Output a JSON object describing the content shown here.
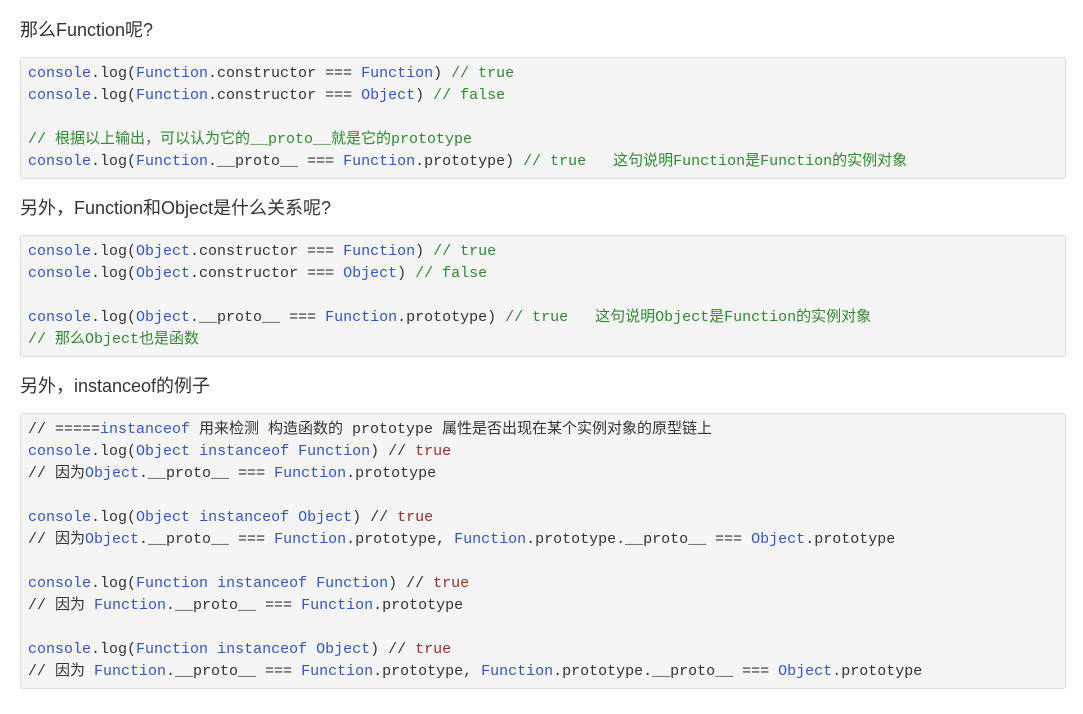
{
  "article": {
    "sections": [
      {
        "heading": "那么Function呢?",
        "lines": [
          [
            {
              "t": "console",
              "c": "#3355cc"
            },
            {
              "t": ".log("
            },
            {
              "t": "Function",
              "c": "#3355cc"
            },
            {
              "t": ".constructor === "
            },
            {
              "t": "Function",
              "c": "#3355cc"
            },
            {
              "t": ") "
            },
            {
              "t": "// true",
              "c": "#2f8b2f"
            }
          ],
          [
            {
              "t": "console",
              "c": "#3355cc"
            },
            {
              "t": ".log("
            },
            {
              "t": "Function",
              "c": "#3355cc"
            },
            {
              "t": ".constructor === "
            },
            {
              "t": "Object",
              "c": "#3355cc"
            },
            {
              "t": ") "
            },
            {
              "t": "// false",
              "c": "#2f8b2f"
            }
          ],
          [],
          [
            {
              "t": "// 根据以上输出，可以认为它的__proto__就是它的prototype",
              "c": "#2f8b2f"
            }
          ],
          [
            {
              "t": "console",
              "c": "#3355cc"
            },
            {
              "t": ".log("
            },
            {
              "t": "Function",
              "c": "#3355cc"
            },
            {
              "t": ".__proto__ === "
            },
            {
              "t": "Function",
              "c": "#3355cc"
            },
            {
              "t": ".prototype) "
            },
            {
              "t": "// true   这句说明Function是Function的实例对象",
              "c": "#2f8b2f"
            }
          ]
        ]
      },
      {
        "heading": "另外，Function和Object是什么关系呢?",
        "lines": [
          [
            {
              "t": "console",
              "c": "#3355cc"
            },
            {
              "t": ".log("
            },
            {
              "t": "Object",
              "c": "#3355cc"
            },
            {
              "t": ".constructor === "
            },
            {
              "t": "Function",
              "c": "#3355cc"
            },
            {
              "t": ") "
            },
            {
              "t": "// true",
              "c": "#2f8b2f"
            }
          ],
          [
            {
              "t": "console",
              "c": "#3355cc"
            },
            {
              "t": ".log("
            },
            {
              "t": "Object",
              "c": "#3355cc"
            },
            {
              "t": ".constructor === "
            },
            {
              "t": "Object",
              "c": "#3355cc"
            },
            {
              "t": ") "
            },
            {
              "t": "// false",
              "c": "#2f8b2f"
            }
          ],
          [],
          [
            {
              "t": "console",
              "c": "#3355cc"
            },
            {
              "t": ".log("
            },
            {
              "t": "Object",
              "c": "#3355cc"
            },
            {
              "t": ".__proto__ === "
            },
            {
              "t": "Function",
              "c": "#3355cc"
            },
            {
              "t": ".prototype) "
            },
            {
              "t": "// true   这句说明Object是Function的实例对象",
              "c": "#2f8b2f"
            }
          ],
          [
            {
              "t": "// 那么Object也是函数",
              "c": "#2f8b2f"
            }
          ]
        ]
      },
      {
        "heading": "另外，instanceof的例子",
        "lines": [
          [
            {
              "t": "// ====="
            },
            {
              "t": "instanceof",
              "c": "#3355cc"
            },
            {
              "t": " 用来检测 构造函数的 prototype 属性是否出现在某个实例对象的原型链上"
            }
          ],
          [
            {
              "t": "console",
              "c": "#3355cc"
            },
            {
              "t": ".log("
            },
            {
              "t": "Object",
              "c": "#3355cc"
            },
            {
              "t": " "
            },
            {
              "t": "instanceof",
              "c": "#3355cc"
            },
            {
              "t": " "
            },
            {
              "t": "Function",
              "c": "#3355cc"
            },
            {
              "t": ") // "
            },
            {
              "t": "true",
              "c": "#a52a2a"
            }
          ],
          [
            {
              "t": "// 因为"
            },
            {
              "t": "Object",
              "c": "#3355cc"
            },
            {
              "t": ".__proto__ === "
            },
            {
              "t": "Function",
              "c": "#3355cc"
            },
            {
              "t": ".prototype"
            }
          ],
          [],
          [
            {
              "t": "console",
              "c": "#3355cc"
            },
            {
              "t": ".log("
            },
            {
              "t": "Object",
              "c": "#3355cc"
            },
            {
              "t": " "
            },
            {
              "t": "instanceof",
              "c": "#3355cc"
            },
            {
              "t": " "
            },
            {
              "t": "Object",
              "c": "#3355cc"
            },
            {
              "t": ") // "
            },
            {
              "t": "true",
              "c": "#a52a2a"
            }
          ],
          [
            {
              "t": "// 因为"
            },
            {
              "t": "Object",
              "c": "#3355cc"
            },
            {
              "t": ".__proto__ === "
            },
            {
              "t": "Function",
              "c": "#3355cc"
            },
            {
              "t": ".prototype, "
            },
            {
              "t": "Function",
              "c": "#3355cc"
            },
            {
              "t": ".prototype.__proto__ === "
            },
            {
              "t": "Object",
              "c": "#3355cc"
            },
            {
              "t": ".prototype"
            }
          ],
          [],
          [
            {
              "t": "console",
              "c": "#3355cc"
            },
            {
              "t": ".log("
            },
            {
              "t": "Function",
              "c": "#3355cc"
            },
            {
              "t": " "
            },
            {
              "t": "instanceof",
              "c": "#3355cc"
            },
            {
              "t": " "
            },
            {
              "t": "Function",
              "c": "#3355cc"
            },
            {
              "t": ") // "
            },
            {
              "t": "true",
              "c": "#a52a2a"
            }
          ],
          [
            {
              "t": "// 因为 "
            },
            {
              "t": "Function",
              "c": "#3355cc"
            },
            {
              "t": ".__proto__ === "
            },
            {
              "t": "Function",
              "c": "#3355cc"
            },
            {
              "t": ".prototype"
            }
          ],
          [],
          [
            {
              "t": "console",
              "c": "#3355cc"
            },
            {
              "t": ".log("
            },
            {
              "t": "Function",
              "c": "#3355cc"
            },
            {
              "t": " "
            },
            {
              "t": "instanceof",
              "c": "#3355cc"
            },
            {
              "t": " "
            },
            {
              "t": "Object",
              "c": "#3355cc"
            },
            {
              "t": ") // "
            },
            {
              "t": "true",
              "c": "#a52a2a"
            }
          ],
          [
            {
              "t": "// 因为 "
            },
            {
              "t": "Function",
              "c": "#3355cc"
            },
            {
              "t": ".__proto__ === "
            },
            {
              "t": "Function",
              "c": "#3355cc"
            },
            {
              "t": ".prototype, "
            },
            {
              "t": "Function",
              "c": "#3355cc"
            },
            {
              "t": ".prototype.__proto__ === "
            },
            {
              "t": "Object",
              "c": "#3355cc"
            },
            {
              "t": ".prototype"
            }
          ]
        ]
      }
    ]
  }
}
